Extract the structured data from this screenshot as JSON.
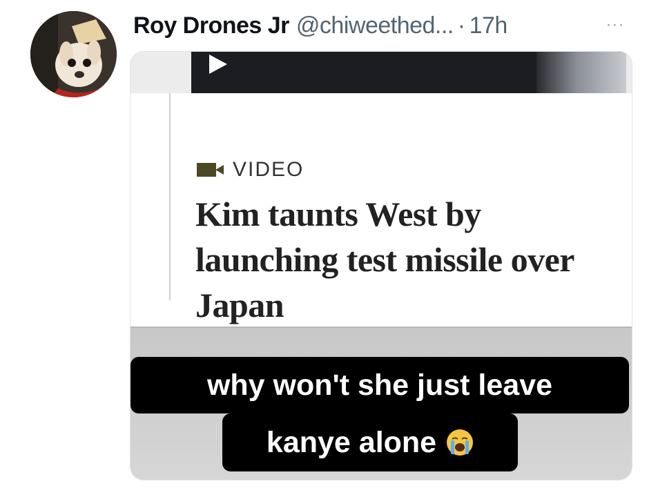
{
  "tweet": {
    "display_name": "Roy Drones Jr",
    "handle": "@chiweethed...",
    "separator": "·",
    "time": "17h",
    "more_label": "···",
    "avatar_icon": "chihuahua-avatar"
  },
  "media": {
    "video_label": "VIDEO",
    "headline": "Kim taunts West by launching test missile over Japan",
    "caption_line1": "why won't she just leave",
    "caption_line2": "kanye alone",
    "caption_emoji": "loudly-crying-face-icon"
  }
}
